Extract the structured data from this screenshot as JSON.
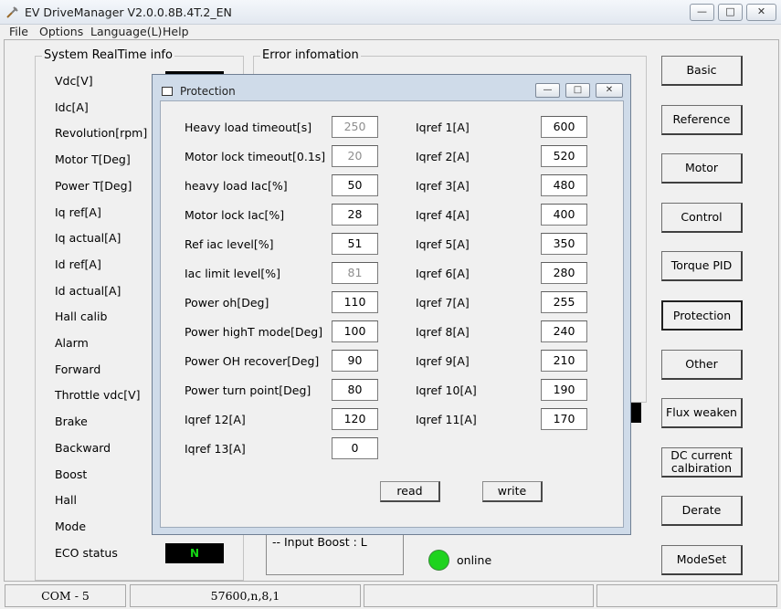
{
  "window": {
    "title": "EV DriveManager V2.0.0.8B.4T.2_EN",
    "minimize_glyph": "—",
    "maximize_glyph": "□",
    "close_glyph": "✕"
  },
  "menu": [
    "File",
    "Options",
    "Language(L)",
    "Help"
  ],
  "realtime": {
    "title": "System RealTime info",
    "labels": [
      "Vdc[V]",
      "Idc[A]",
      "Revolution[rpm]",
      "Motor T[Deg]",
      "Power T[Deg]",
      "Iq ref[A]",
      "Iq actual[A]",
      "Id ref[A]",
      "Id actual[A]",
      "Hall calib",
      "Alarm",
      "Forward",
      "Throttle vdc[V]",
      "Brake",
      "Backward",
      "Boost",
      "Hall",
      "Mode",
      "ECO status"
    ],
    "eco_value": "N"
  },
  "error_info": {
    "title": "Error infomation",
    "boost_text": "--  Input Boost : L"
  },
  "online": {
    "label": "online",
    "color": "#1ed31e"
  },
  "side_buttons": [
    "Basic",
    "Reference",
    "Motor",
    "Control",
    "Torque PID",
    "Protection",
    "Other",
    "Flux weaken",
    "DC current calbiration",
    "Derate",
    "ModeSet"
  ],
  "status": {
    "port": "COM - 5",
    "settings": "57600,n,8,1"
  },
  "dialog": {
    "title": "Protection",
    "left": [
      {
        "label": "Heavy load timeout[s]",
        "value": "250",
        "disabled": true
      },
      {
        "label": "Motor lock timeout[0.1s]",
        "value": "20",
        "disabled": true
      },
      {
        "label": "heavy load Iac[%]",
        "value": "50",
        "disabled": false
      },
      {
        "label": "Motor lock Iac[%]",
        "value": "28",
        "disabled": false
      },
      {
        "label": "Ref iac level[%]",
        "value": "51",
        "disabled": false
      },
      {
        "label": "Iac limit level[%]",
        "value": "81",
        "disabled": true
      },
      {
        "label": "Power oh[Deg]",
        "value": "110",
        "disabled": false
      },
      {
        "label": "Power highT mode[Deg]",
        "value": "100",
        "disabled": false
      },
      {
        "label": "Power OH recover[Deg]",
        "value": "90",
        "disabled": false
      },
      {
        "label": "Power turn point[Deg]",
        "value": "80",
        "disabled": false
      },
      {
        "label": "Iqref 12[A]",
        "value": "120",
        "disabled": false
      },
      {
        "label": "Iqref 13[A]",
        "value": "0",
        "disabled": false
      }
    ],
    "right": [
      {
        "label": "Iqref 1[A]",
        "value": "600"
      },
      {
        "label": "Iqref 2[A]",
        "value": "520"
      },
      {
        "label": "Iqref 3[A]",
        "value": "480"
      },
      {
        "label": "Iqref 4[A]",
        "value": "400"
      },
      {
        "label": "Iqref 5[A]",
        "value": "350"
      },
      {
        "label": "Iqref 6[A]",
        "value": "280"
      },
      {
        "label": "Iqref 7[A]",
        "value": "255"
      },
      {
        "label": "Iqref 8[A]",
        "value": "240"
      },
      {
        "label": "Iqref 9[A]",
        "value": "210"
      },
      {
        "label": "Iqref 10[A]",
        "value": "190"
      },
      {
        "label": "Iqref 11[A]",
        "value": "170"
      }
    ],
    "read_label": "read",
    "write_label": "write"
  }
}
